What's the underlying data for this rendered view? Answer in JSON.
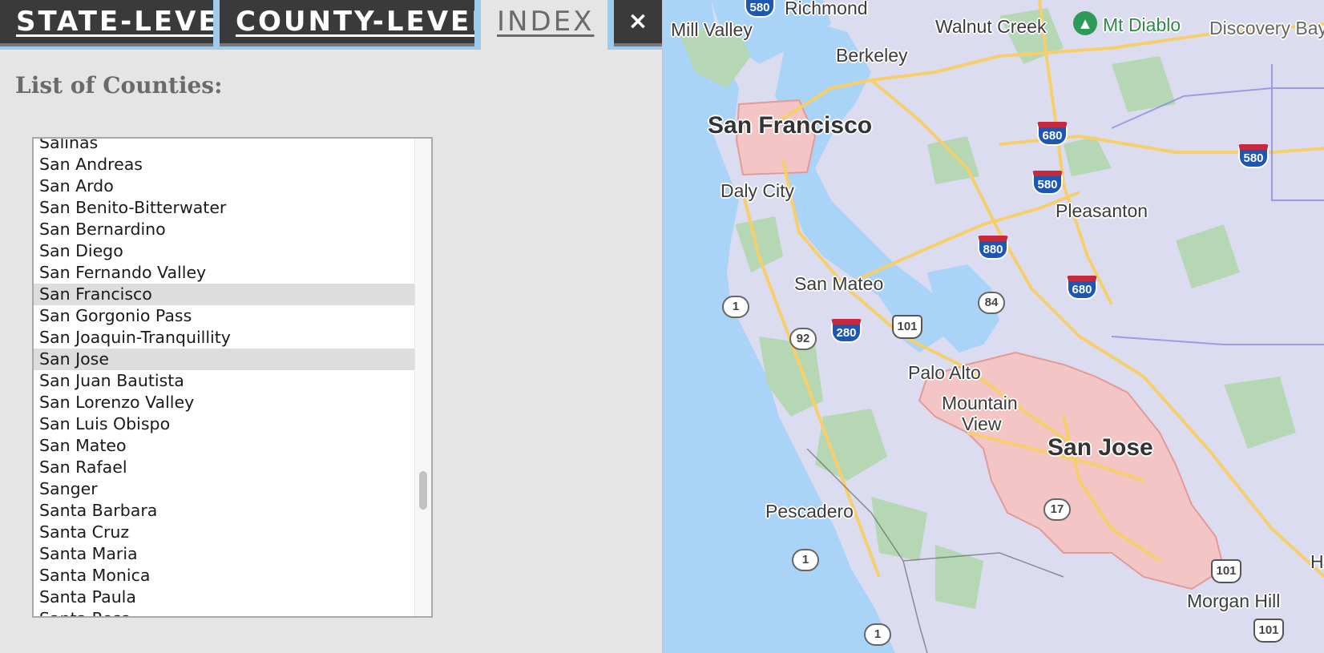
{
  "tabs": [
    {
      "label": "STATE-LEVEL",
      "active": false
    },
    {
      "label": "COUNTY-LEVEL",
      "active": false
    },
    {
      "label": "INDEX",
      "active": true
    }
  ],
  "close_label": "×",
  "list_title": "List of Counties:",
  "counties": [
    "Salinas",
    "San Andreas",
    "San Ardo",
    "San Benito-Bitterwater",
    "San Bernardino",
    "San Diego",
    "San Fernando Valley",
    "San Francisco",
    "San Gorgonio Pass",
    "San Joaquin-Tranquillity",
    "San Jose",
    "San Juan Bautista",
    "San Lorenzo Valley",
    "San Luis Obispo",
    "San Mateo",
    "San Rafael",
    "Sanger",
    "Santa Barbara",
    "Santa Cruz",
    "Santa Maria",
    "Santa Monica",
    "Santa Paula",
    "Santa Rosa"
  ],
  "selected_counties": [
    "San Francisco",
    "San Jose"
  ],
  "map": {
    "places": {
      "richmond": "Richmond",
      "mill_valley": "Mill Valley",
      "walnut_creek": "Walnut Creek",
      "mt_diablo": "Mt Diablo",
      "discovery_bay": "Discovery Bay",
      "berkeley": "Berkeley",
      "san_francisco": "San Francisco",
      "daly_city": "Daly City",
      "pleasanton": "Pleasanton",
      "san_mateo": "San Mateo",
      "palo_alto": "Palo Alto",
      "mountain_view_1": "Mountain",
      "mountain_view_2": "View",
      "san_jose": "San Jose",
      "pescadero": "Pescadero",
      "morgan_hill": "Morgan Hill",
      "h_edge": "H"
    },
    "shields": {
      "i580_top": "580",
      "i680_a": "680",
      "i580_b": "580",
      "i580_c": "580",
      "i880": "880",
      "i680_b": "680",
      "i280": "280",
      "us101_a": "101",
      "us101_b": "101",
      "us101_c": "101",
      "ca1_a": "1",
      "ca1_b": "1",
      "ca1_c": "1",
      "ca92": "92",
      "ca84": "84",
      "ca17": "17"
    },
    "colors": {
      "water": "#a9d3f7",
      "land": "#dcdcf0",
      "park": "#b5d7b4",
      "highlight": "#f3c5c4",
      "road": "#f6cf6c"
    }
  }
}
